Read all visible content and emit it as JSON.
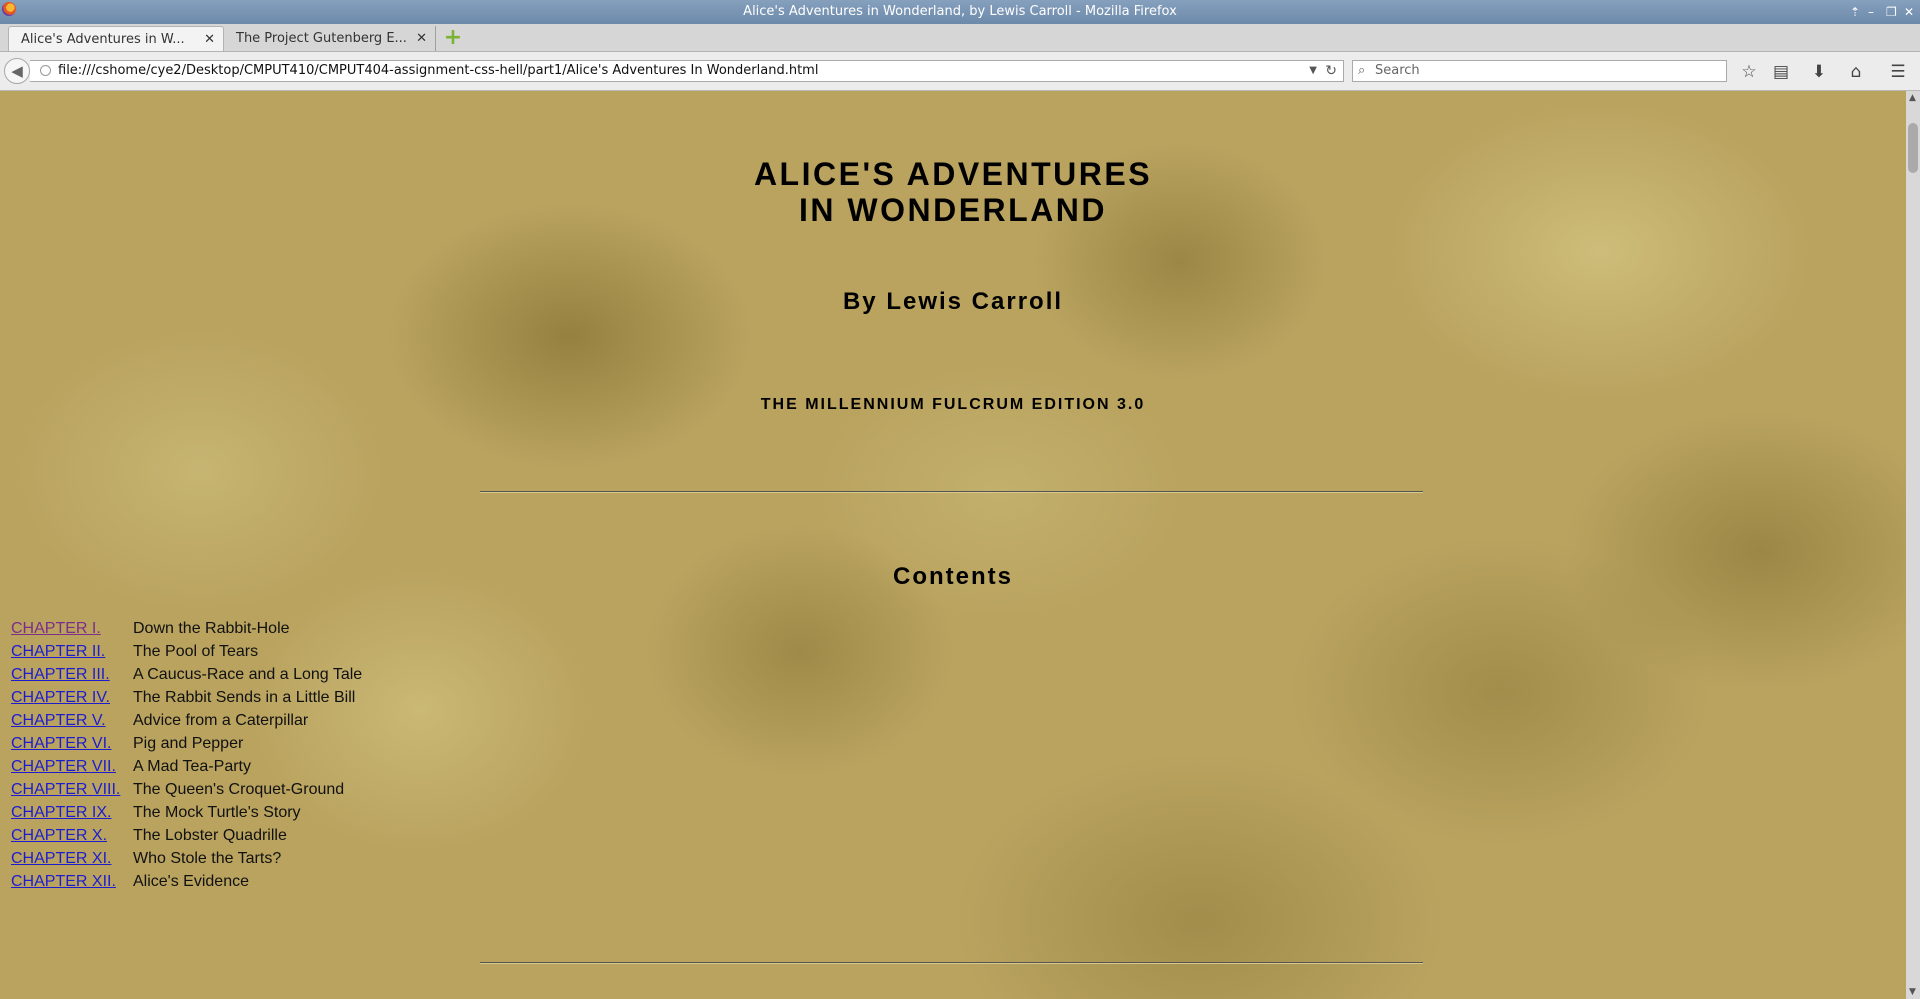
{
  "window": {
    "title": "Alice's Adventures in Wonderland, by Lewis Carroll - Mozilla Firefox",
    "controls": [
      "⇡",
      "–",
      "❐",
      "✕"
    ]
  },
  "tabs": [
    {
      "label": "Alice's Adventures in W...",
      "active": true
    },
    {
      "label": "The Project Gutenberg E...",
      "active": false
    }
  ],
  "newtab_label": "+",
  "navbar": {
    "url": "file:///cshome/cye2/Desktop/CMPUT410/CMPUT404-assignment-css-hell/part1/Alice's Adventures In Wonderland.html",
    "search_placeholder": "Search",
    "icons": [
      "bookmark-star-icon",
      "reading-list-icon",
      "download-icon",
      "home-icon",
      "menu-icon"
    ]
  },
  "page": {
    "title_line1": "ALICE'S ADVENTURES",
    "title_line2": "IN WONDERLAND",
    "author": "By Lewis Carroll",
    "edition": "THE MILLENNIUM FULCRUM EDITION 3.0",
    "contents_heading": "Contents",
    "toc": [
      {
        "chapter": "CHAPTER I.",
        "title": "Down the Rabbit-Hole",
        "visited": true
      },
      {
        "chapter": "CHAPTER II.",
        "title": "The Pool of Tears",
        "visited": false
      },
      {
        "chapter": "CHAPTER III.",
        "title": "A Caucus-Race and a Long Tale",
        "visited": false
      },
      {
        "chapter": "CHAPTER IV.",
        "title": "The Rabbit Sends in a Little Bill",
        "visited": false
      },
      {
        "chapter": "CHAPTER V.",
        "title": "Advice from a Caterpillar",
        "visited": false
      },
      {
        "chapter": "CHAPTER VI.",
        "title": "Pig and Pepper",
        "visited": false
      },
      {
        "chapter": "CHAPTER VII.",
        "title": "A Mad Tea-Party",
        "visited": false
      },
      {
        "chapter": "CHAPTER VIII.",
        "title": "The Queen's Croquet-Ground",
        "visited": false
      },
      {
        "chapter": "CHAPTER IX.",
        "title": "The Mock Turtle's Story",
        "visited": false
      },
      {
        "chapter": "CHAPTER X.",
        "title": "The Lobster Quadrille",
        "visited": false
      },
      {
        "chapter": "CHAPTER XI.",
        "title": "Who Stole the Tarts?",
        "visited": false
      },
      {
        "chapter": "CHAPTER XII.",
        "title": "Alice's Evidence",
        "visited": false
      }
    ]
  },
  "colors": {
    "link": "#1d1dcf",
    "visited_link": "#7d2d8a",
    "parchment": "#b9a35f"
  }
}
